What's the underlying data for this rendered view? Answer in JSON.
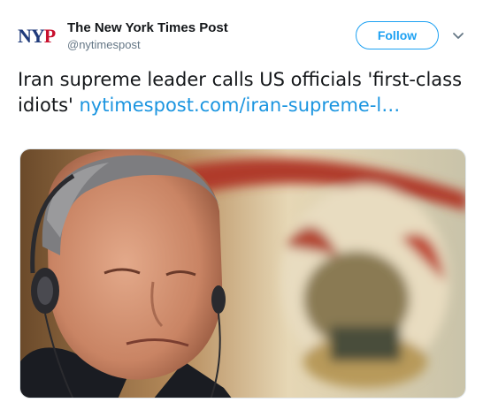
{
  "account": {
    "avatar_text_n": "N",
    "avatar_text_y": "Y",
    "avatar_text_p": "P",
    "display_name": "The New York Times Post",
    "handle": "@nytimespost"
  },
  "actions": {
    "follow_label": "Follow",
    "more_icon": "chevron-down-icon"
  },
  "tweet": {
    "text": "Iran supreme leader calls US officials 'first-class idiots' ",
    "link_text": "nytimespost.com/iran-supreme-l…"
  },
  "media": {
    "kind": "photo"
  },
  "colors": {
    "accent": "#1da1f2",
    "link": "#1b95e0",
    "text": "#14171a",
    "secondary": "#657786",
    "logo_blue": "#1f3a7a",
    "logo_red": "#c8102e"
  }
}
